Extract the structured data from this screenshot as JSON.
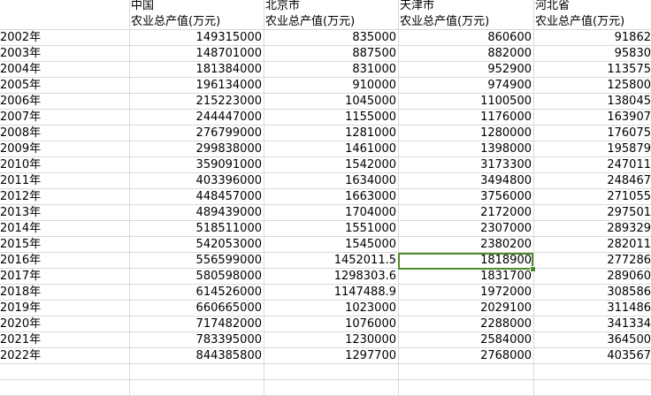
{
  "header": {
    "row1": [
      "",
      "中国",
      "北京市",
      "天津市",
      "河北省"
    ],
    "row2": [
      "",
      "农业总产值(万元)",
      "农业总产值(万元)",
      "农业总产值(万元)",
      "农业总产值(万元)"
    ]
  },
  "rows": [
    [
      "2002年",
      "149315000",
      "835000",
      "860600",
      "91862"
    ],
    [
      "2003年",
      "148701000",
      "887500",
      "882000",
      "95830"
    ],
    [
      "2004年",
      "181384000",
      "831000",
      "952900",
      "113575"
    ],
    [
      "2005年",
      "196134000",
      "910000",
      "974900",
      "125800"
    ],
    [
      "2006年",
      "215223000",
      "1045000",
      "1100500",
      "138045"
    ],
    [
      "2007年",
      "244447000",
      "1155000",
      "1176000",
      "163907"
    ],
    [
      "2008年",
      "276799000",
      "1281000",
      "1280000",
      "176075"
    ],
    [
      "2009年",
      "299838000",
      "1461000",
      "1398000",
      "195879"
    ],
    [
      "2010年",
      "359091000",
      "1542000",
      "3173300",
      "247011"
    ],
    [
      "2011年",
      "403396000",
      "1634000",
      "3494800",
      "248467"
    ],
    [
      "2012年",
      "448457000",
      "1663000",
      "3756000",
      "271055"
    ],
    [
      "2013年",
      "489439000",
      "1704000",
      "2172000",
      "297501"
    ],
    [
      "2014年",
      "518511000",
      "1551000",
      "2307000",
      "289329"
    ],
    [
      "2015年",
      "542053000",
      "1545000",
      "2380200",
      "282011"
    ],
    [
      "2016年",
      "556599000",
      "1452011.5",
      "1818900",
      "277286"
    ],
    [
      "2017年",
      "580598000",
      "1298303.6",
      "1831700",
      "289060"
    ],
    [
      "2018年",
      "614526000",
      "1147488.9",
      "1972000",
      "308586"
    ],
    [
      "2019年",
      "660665000",
      "1023000",
      "2029100",
      "311486"
    ],
    [
      "2020年",
      "717482000",
      "1076000",
      "2288000",
      "341334"
    ],
    [
      "2021年",
      "783395000",
      "1230000",
      "2584000",
      "364500"
    ],
    [
      "2022年",
      "844385800",
      "1297700",
      "2768000",
      "403567"
    ]
  ],
  "selected_cell": {
    "row": 14,
    "col": 3
  },
  "colors": {
    "grid": "#d9d9d9",
    "selection": "#4f8a2f"
  }
}
